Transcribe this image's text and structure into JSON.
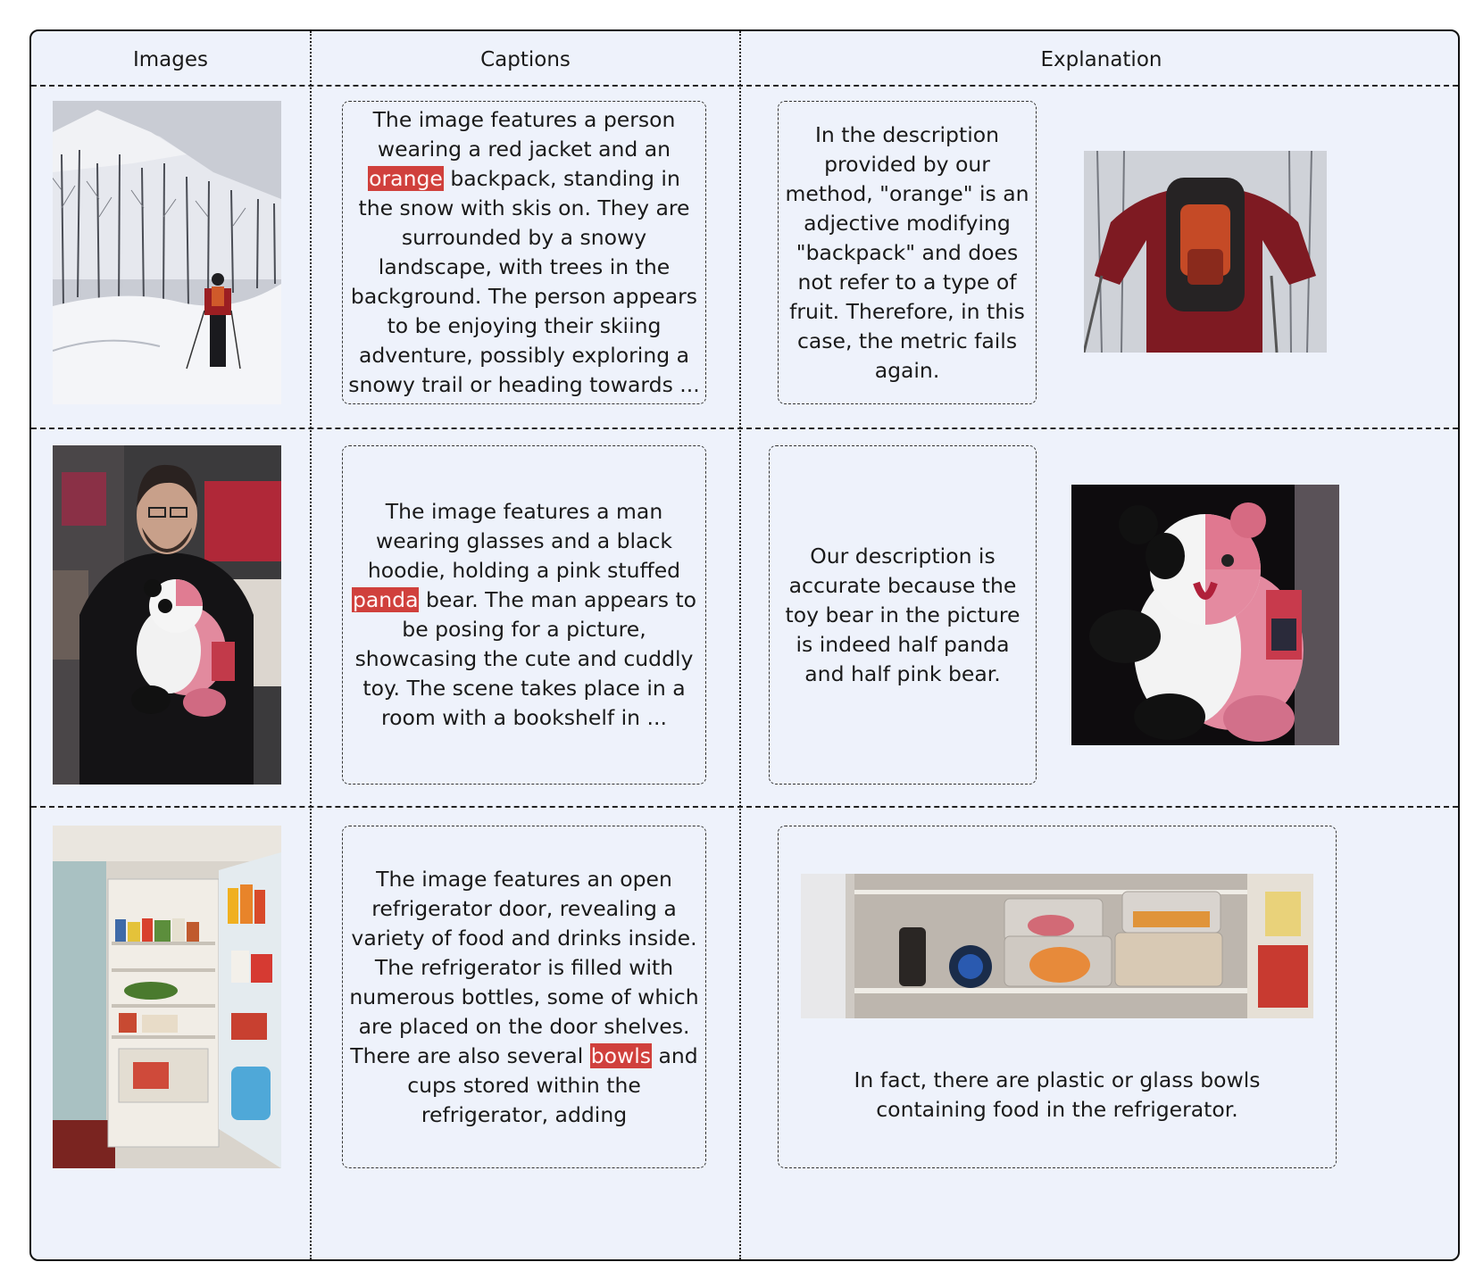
{
  "headers": {
    "images": "Images",
    "captions": "Captions",
    "explanation": "Explanation"
  },
  "rows": [
    {
      "caption_before": "The image features a person wearing a red jacket and an ",
      "caption_highlight": "orange",
      "caption_after": " backpack, standing in the snow with skis on. They are surrounded by a snowy landscape, with trees in the background. The person appears to be enjoying their skiing adventure, possibly exploring a snowy trail or heading towards ...",
      "explanation": "In the description provided by our method, \"orange\" is an adjective modifying \"backpack\" and does not refer to a type of fruit. Therefore, in this case, the metric fails again."
    },
    {
      "caption_before": "The image features a man wearing glasses and a black hoodie, holding a pink stuffed ",
      "caption_highlight": "panda",
      "caption_after": " bear. The man appears to be posing for a picture, showcasing the cute and cuddly toy. The scene takes place in a room with a bookshelf in ...",
      "explanation": "Our description is accurate because the toy bear in the picture is indeed half panda and half pink bear."
    },
    {
      "caption_before": "The image features an open refrigerator door, revealing a variety of food and drinks inside. The refrigerator is filled with numerous bottles, some of which are placed on the door shelves. There are also several ",
      "caption_highlight": "bowls",
      "caption_after": " and cups stored within the refrigerator, adding",
      "explanation": "In fact, there are plastic or glass bowls containing food in the refrigerator."
    }
  ],
  "colors": {
    "background": "#eef2fb",
    "highlight": "#d0403c",
    "border": "#111111"
  }
}
